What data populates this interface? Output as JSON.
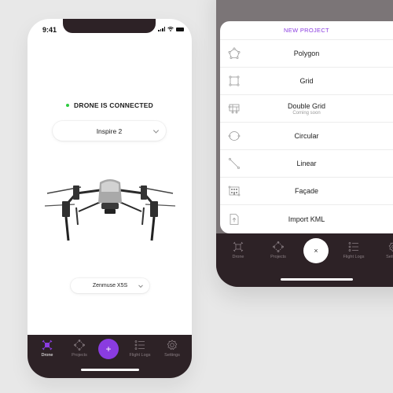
{
  "status_bar": {
    "time": "9:41"
  },
  "connection": {
    "status_text": "DRONE IS CONNECTED",
    "status_color": "#2ecc40"
  },
  "drone_selector": {
    "value": "Inspire 2"
  },
  "camera_selector": {
    "value": "Zenmuse X5S"
  },
  "drone_image": {
    "alt": "drone-quadcopter-image"
  },
  "tab_bar": {
    "items": [
      {
        "label": "Drone",
        "icon": "drone-icon"
      },
      {
        "label": "Projects",
        "icon": "projects-icon"
      },
      {
        "label": "Flight Logs",
        "icon": "flight-logs-icon"
      },
      {
        "label": "Settings",
        "icon": "settings-icon"
      }
    ],
    "add_label": "+",
    "close_label": "×",
    "settings_truncated": "Set"
  },
  "new_project_sheet": {
    "title": "NEW PROJECT",
    "options": [
      {
        "label": "Polygon",
        "icon": "polygon-icon"
      },
      {
        "label": "Grid",
        "icon": "grid-icon"
      },
      {
        "label": "Double Grid",
        "sub": "Coming soon",
        "icon": "double-grid-icon"
      },
      {
        "label": "Circular",
        "icon": "circular-icon"
      },
      {
        "label": "Linear",
        "icon": "linear-icon"
      },
      {
        "label": "Façade",
        "icon": "facade-icon"
      },
      {
        "label": "Import KML",
        "icon": "import-kml-icon"
      }
    ]
  },
  "colors": {
    "accent": "#8a3ce0",
    "tab_bar_bg": "#2d2226",
    "overlay": "#7b7577"
  }
}
